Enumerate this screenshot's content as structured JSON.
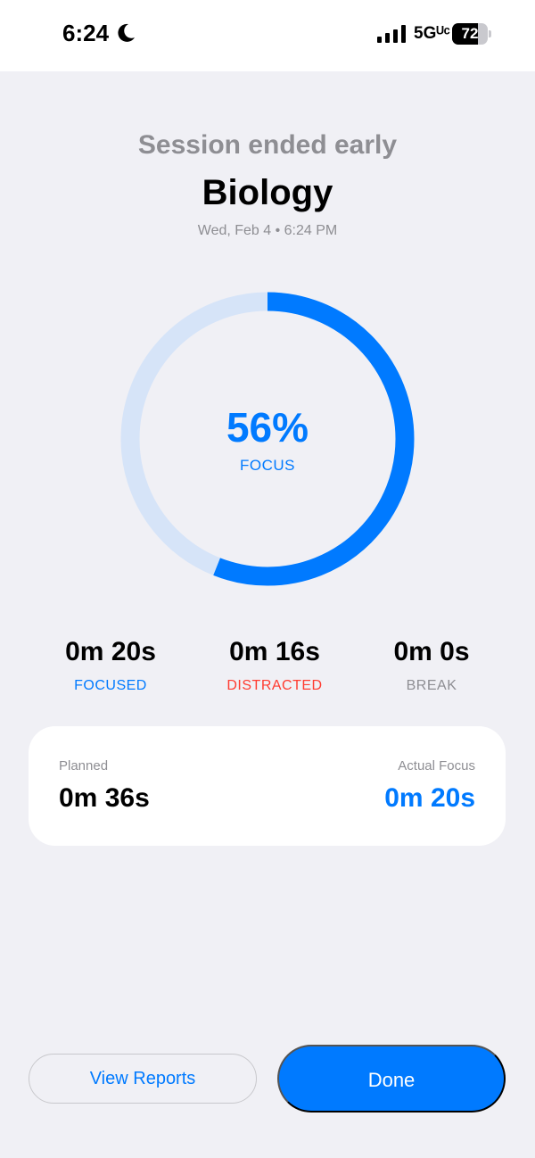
{
  "status_bar": {
    "time": "6:24",
    "moon_icon": "moon-icon",
    "signal_icon": "cellular-signal-icon",
    "network": "5Gᵁᶜ",
    "battery_percent": "72",
    "battery_level": 0.72
  },
  "session": {
    "status": "Session ended early",
    "subject": "Biology",
    "date": "Wed, Feb 4 • 6:24 PM"
  },
  "focus_ring": {
    "percent_text": "56%",
    "percent_value": 0.56,
    "label": "FOCUS",
    "color_progress": "#007aff",
    "color_track": "#d6e4f8"
  },
  "stats": [
    {
      "value": "0m 20s",
      "label": "FOCUSED",
      "color": "#007aff"
    },
    {
      "value": "0m 16s",
      "label": "DISTRACTED",
      "color": "#ff3b30"
    },
    {
      "value": "0m 0s",
      "label": "BREAK",
      "color": "#8e8e93"
    }
  ],
  "summary": {
    "planned_label": "Planned",
    "planned_value": "0m 36s",
    "actual_label": "Actual Focus",
    "actual_value": "0m 20s"
  },
  "actions": {
    "view_reports_label": "View Reports",
    "done_label": "Done"
  },
  "colors": {
    "accent": "#007aff",
    "background": "#f0f0f5",
    "secondary_text": "#8e8e93"
  }
}
